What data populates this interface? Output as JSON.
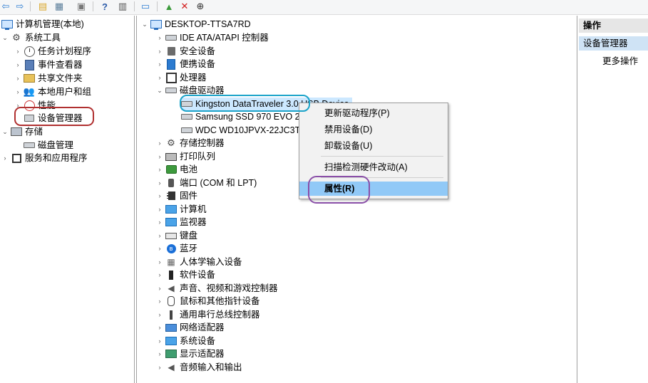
{
  "toolbar": {
    "buttons": [
      "back-arrow",
      "forward-arrow",
      "up-folder",
      "show-hide-tree",
      "properties",
      "help",
      "action-pane",
      "update-driver",
      "disable",
      "uninstall",
      "scan"
    ]
  },
  "left_tree": {
    "root": "计算机管理(本地)",
    "system_tools": "系统工具",
    "task_scheduler": "任务计划程序",
    "event_viewer": "事件查看器",
    "shared_folders": "共享文件夹",
    "local_users": "本地用户和组",
    "performance": "性能",
    "device_manager": "设备管理器",
    "storage": "存储",
    "disk_management": "磁盘管理",
    "services": "服务和应用程序"
  },
  "device_tree": {
    "computer": "DESKTOP-TTSA7RD",
    "categories": [
      "IDE ATA/ATAPI 控制器",
      "安全设备",
      "便携设备",
      "处理器",
      "磁盘驱动器"
    ],
    "disks": [
      "Kingston DataTraveler 3.0 USB Device",
      "Samsung SSD 970 EVO 2",
      "WDC WD10JPVX-22JC3T"
    ],
    "categories2": [
      "存储控制器",
      "打印队列",
      "电池",
      "端口 (COM 和 LPT)",
      "固件",
      "计算机",
      "监视器",
      "键盘",
      "蓝牙",
      "人体学输入设备",
      "软件设备",
      "声音、视频和游戏控制器",
      "鼠标和其他指针设备",
      "通用串行总线控制器",
      "网络适配器",
      "系统设备",
      "显示适配器",
      "音频输入和输出"
    ]
  },
  "context_menu": {
    "update_driver": "更新驱动程序(P)",
    "disable_device": "禁用设备(D)",
    "uninstall_device": "卸载设备(U)",
    "scan_hardware": "扫描检测硬件改动(A)",
    "properties": "属性(R)"
  },
  "actions_pane": {
    "header": "操作",
    "section": "设备管理器",
    "more_actions": "更多操作"
  },
  "colors": {
    "highlight_selected": "#cce8ff",
    "menu_hover": "#91c9f7",
    "annotation_red": "#b03030",
    "annotation_teal": "#1aa3c9",
    "annotation_purple": "#8a4fa8"
  }
}
